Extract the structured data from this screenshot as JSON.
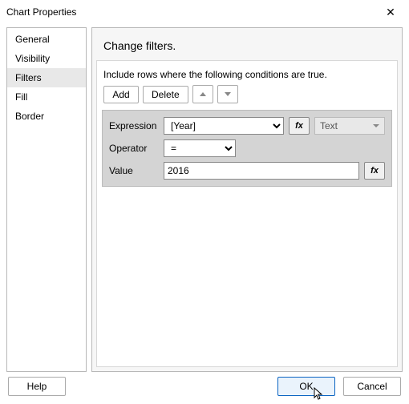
{
  "window": {
    "title": "Chart Properties",
    "close_glyph": "✕"
  },
  "sidebar": {
    "items": [
      {
        "label": "General"
      },
      {
        "label": "Visibility"
      },
      {
        "label": "Filters"
      },
      {
        "label": "Fill"
      },
      {
        "label": "Border"
      }
    ],
    "active_index": 2
  },
  "panel": {
    "heading": "Change filters.",
    "instruction": "Include rows where the following conditions are true.",
    "buttons": {
      "add": "Add",
      "delete": "Delete"
    },
    "form": {
      "expression_label": "Expression",
      "expression_value": "[Year]",
      "fx": "fx",
      "type_value": "Text",
      "operator_label": "Operator",
      "operator_value": "=",
      "value_label": "Value",
      "value_value": "2016"
    }
  },
  "footer": {
    "help": "Help",
    "ok": "OK",
    "cancel": "Cancel"
  }
}
